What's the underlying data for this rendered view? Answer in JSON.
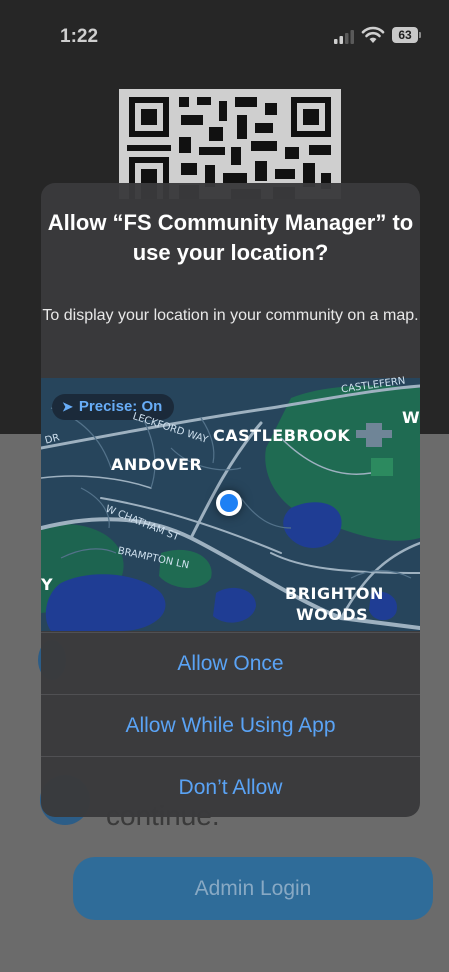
{
  "status_bar": {
    "time": "1:22",
    "battery": "63"
  },
  "background": {
    "admin_button": "Admin Login",
    "partial_text": "continue."
  },
  "alert": {
    "title": "Allow “FS Community Manager” to use your location?",
    "message": "To display your location in your community on a map.",
    "precise_label": "Precise: On",
    "map_labels": {
      "castlebrook": "CASTLEBROOK",
      "andover": "ANDOVER",
      "brighton": "BRIGHTON",
      "woods": "WOODS",
      "castleferns": "CASTLEFERN",
      "wi": "WI",
      "y": "Y",
      "leckford": "LECKFORD WAY",
      "chatham": "W CHATHAM ST",
      "brampton": "BRAMPTON LN",
      "dr": "DR"
    },
    "buttons": {
      "allow_once": "Allow Once",
      "allow_while_using": "Allow While Using App",
      "dont_allow": "Don’t Allow"
    }
  },
  "colors": {
    "accent": "#5aa3f5",
    "location_dot": "#1e80f4",
    "map_water": "#1f3d94",
    "map_green": "#1f6b52"
  }
}
